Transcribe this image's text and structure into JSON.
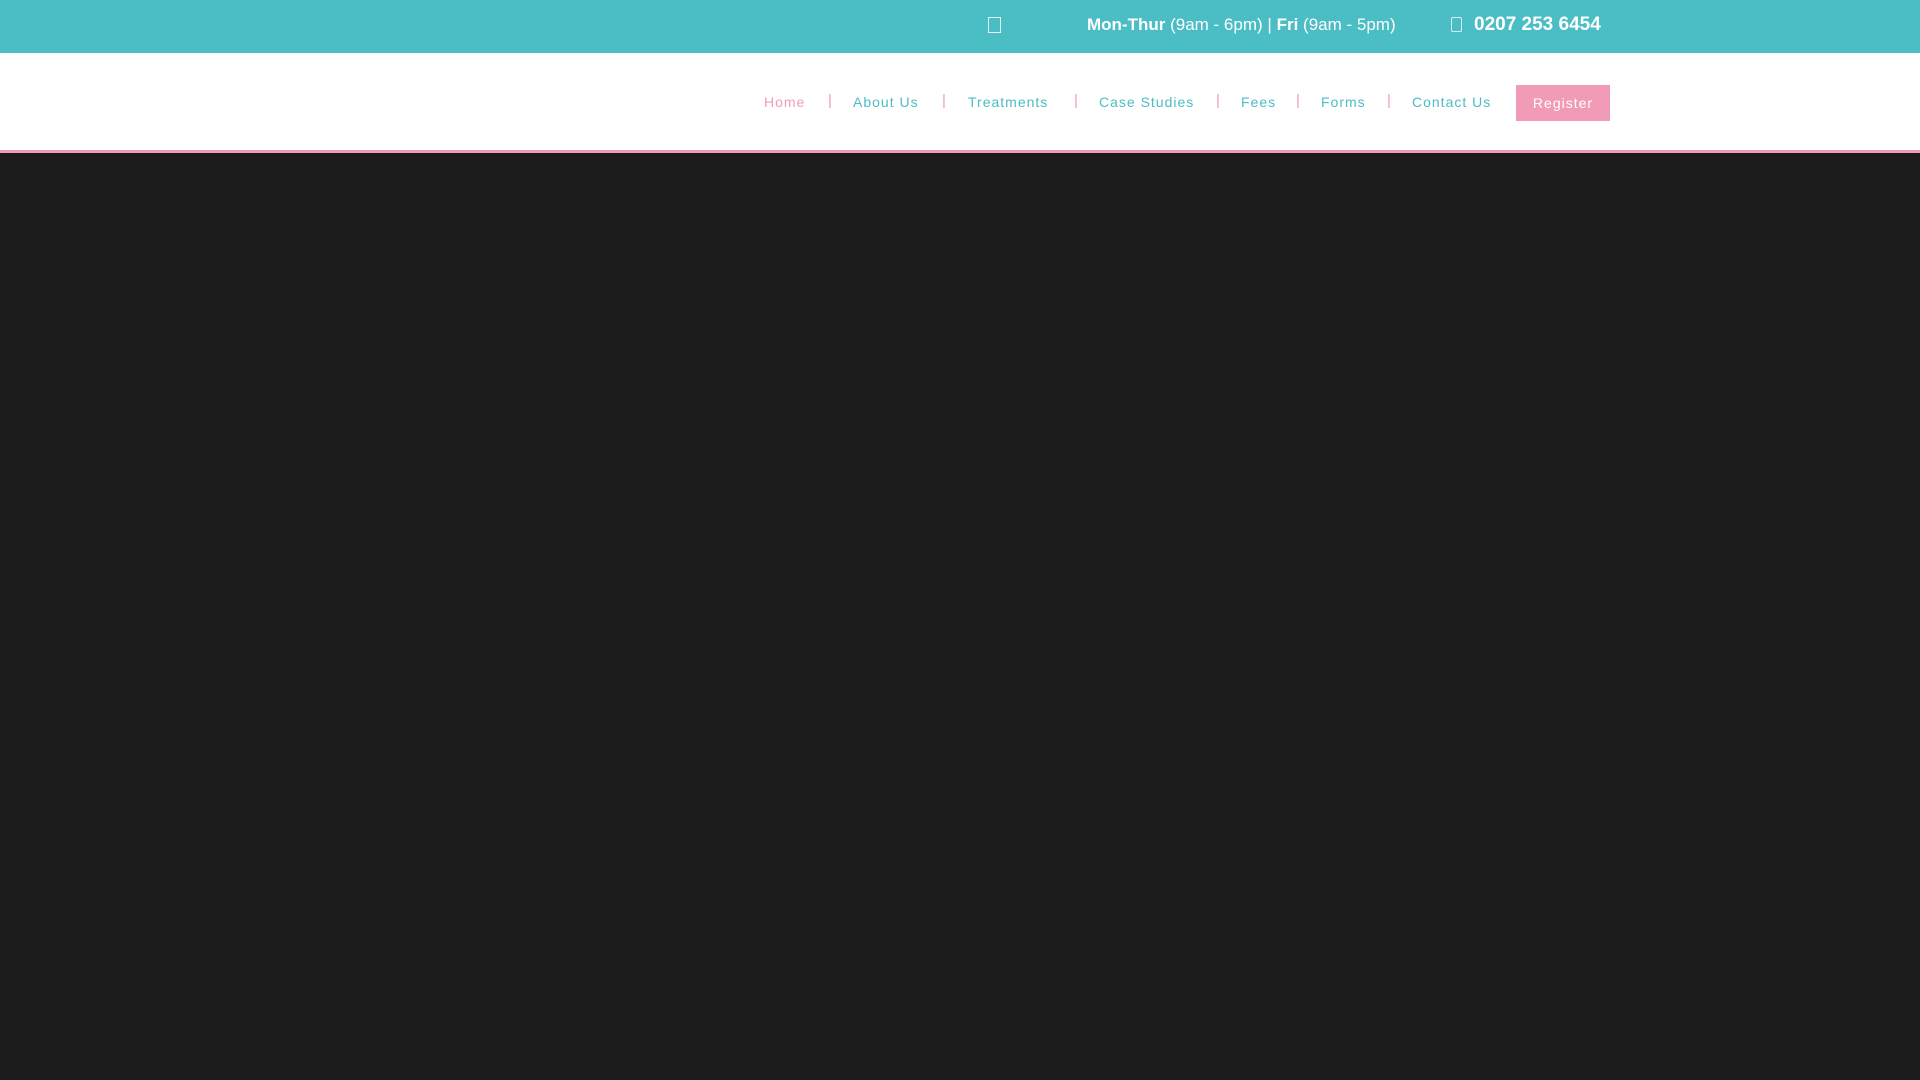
{
  "topbar": {
    "hours_label_1": "Mon-Thur",
    "hours_value_1": "(9am - 6pm)",
    "hours_separator": "|",
    "hours_label_2": "Fri",
    "hours_value_2": "(9am - 5pm)",
    "phone": "0207 253 6454",
    "clock_icon": "clock-icon",
    "phone_icon": "phone-icon"
  },
  "nav": {
    "items": [
      {
        "label": "Home",
        "active": true
      },
      {
        "label": "About Us"
      },
      {
        "label": "Treatments"
      },
      {
        "label": "Case Studies"
      },
      {
        "label": "Fees"
      },
      {
        "label": "Forms"
      },
      {
        "label": "Contact Us"
      }
    ],
    "separator": "|",
    "register_label": "Register"
  },
  "colors": {
    "accent_teal": "#4bbdc4",
    "accent_pink": "#f29bb6",
    "hero_background": "#1b1b1b"
  }
}
